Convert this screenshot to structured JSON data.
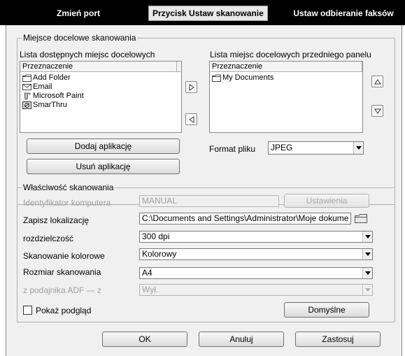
{
  "tabs": [
    {
      "label": "Zmień port"
    },
    {
      "label": "Przycisk Ustaw skanowanie"
    },
    {
      "label": "Ustaw odbieranie faksów"
    }
  ],
  "destinations": {
    "legend": "Miejsce docelowe skanowania",
    "available_label": "Lista dostępnych miejsc docelowych",
    "available_header": "Przeznaczenie",
    "available_items": [
      {
        "label": "Add Folder",
        "icon": "folder-icon"
      },
      {
        "label": "Email",
        "icon": "envelope-icon"
      },
      {
        "label": "Microsoft Paint",
        "icon": "paint-icon"
      },
      {
        "label": "SmarThru",
        "icon": "smarthru-icon"
      }
    ],
    "front_label": "Lista miejsc docelowych przedniego panelu",
    "front_header": "Przeznaczenie",
    "front_items": [
      {
        "label": "My Documents",
        "icon": "folder-icon"
      }
    ],
    "add_app": "Dodaj aplikację",
    "remove_app": "Usuń aplikację",
    "format_label": "Format pliku",
    "format_value": "JPEG"
  },
  "properties": {
    "legend": "Właściwość skanowania",
    "computer_id_label": "Identyfikator komputera",
    "computer_id_value": "MANUAL",
    "settings_button": "Ustawienia",
    "save_location_label": "Zapisz lokalizację",
    "save_location_value": "C:\\Documents and Settings\\Administrator\\Moje dokume",
    "resolution_label": "rozdzielczość",
    "resolution_value": "300 dpi",
    "color_label": "Skanowanie kolorowe",
    "color_value": "Kolorowy",
    "size_label": "Rozmiar skanowania",
    "size_value": "A4",
    "adf_label": "z podajnika ADF — z",
    "adf_value": "Wył.",
    "preview_label": "Pokaż podgląd",
    "defaults_button": "Domyślne"
  },
  "footer": {
    "ok": "OK",
    "cancel": "Anuluj",
    "apply": "Zastosuj"
  }
}
